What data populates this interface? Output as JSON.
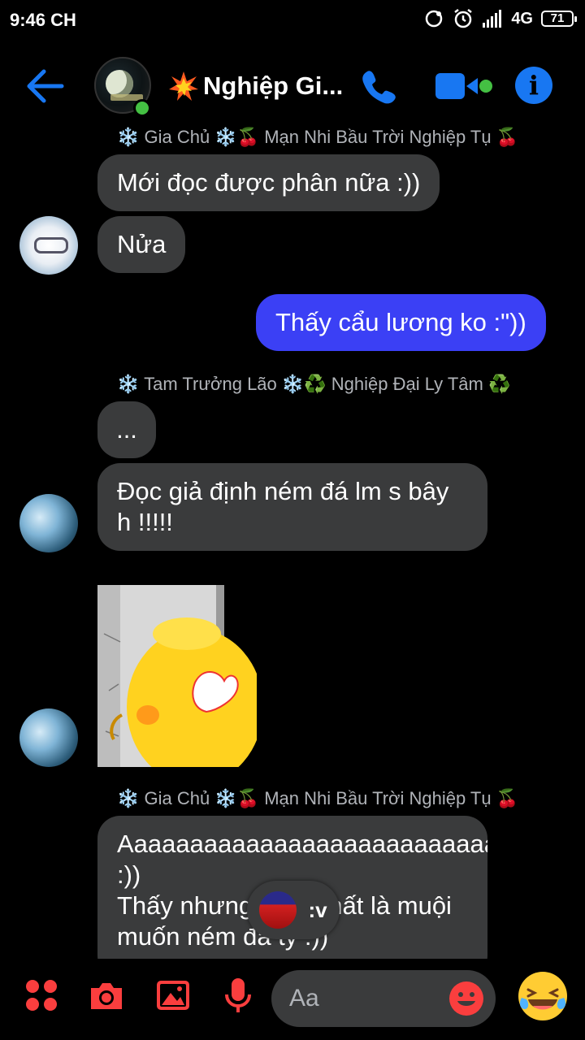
{
  "status_bar": {
    "time": "9:46 CH",
    "network": "4G",
    "battery": "71"
  },
  "header": {
    "title": "Nghiệp Gi..."
  },
  "messages": {
    "sender1_top": "❄️ Gia Chủ ❄️🍒 Mạn Nhi Bầu Trời Nghiệp Tụ 🍒",
    "m1": "Mới đọc được phân nữa :))",
    "m2": "Nửa",
    "m3": "Thấy cẩu lương ko :\"))",
    "sender2": "❄️ Tam Trưởng Lão ❄️♻️ Nghiệp Đại Ly Tâm ♻️",
    "m4": "...",
    "m5": "Đọc giả định ném đá lm s bây h !!!!!",
    "sender3": "❄️ Gia Chủ ❄️🍒 Mạn Nhi Bầu Trời Nghiệp Tụ 🍒",
    "m6": "Aaaaaaaaaaaaaaaaaaaaaaaaaaa :))\nThấy nhưng thấy nhất là muội muốn ném đá tỷ :))"
  },
  "reaction": {
    "text": ":v"
  },
  "composer": {
    "placeholder": "Aa"
  },
  "colors": {
    "accent": "#1877f2",
    "bottom_accent": "#fa3e3e",
    "my_bubble": "#3b40f5",
    "their_bubble": "#3a3b3c"
  }
}
